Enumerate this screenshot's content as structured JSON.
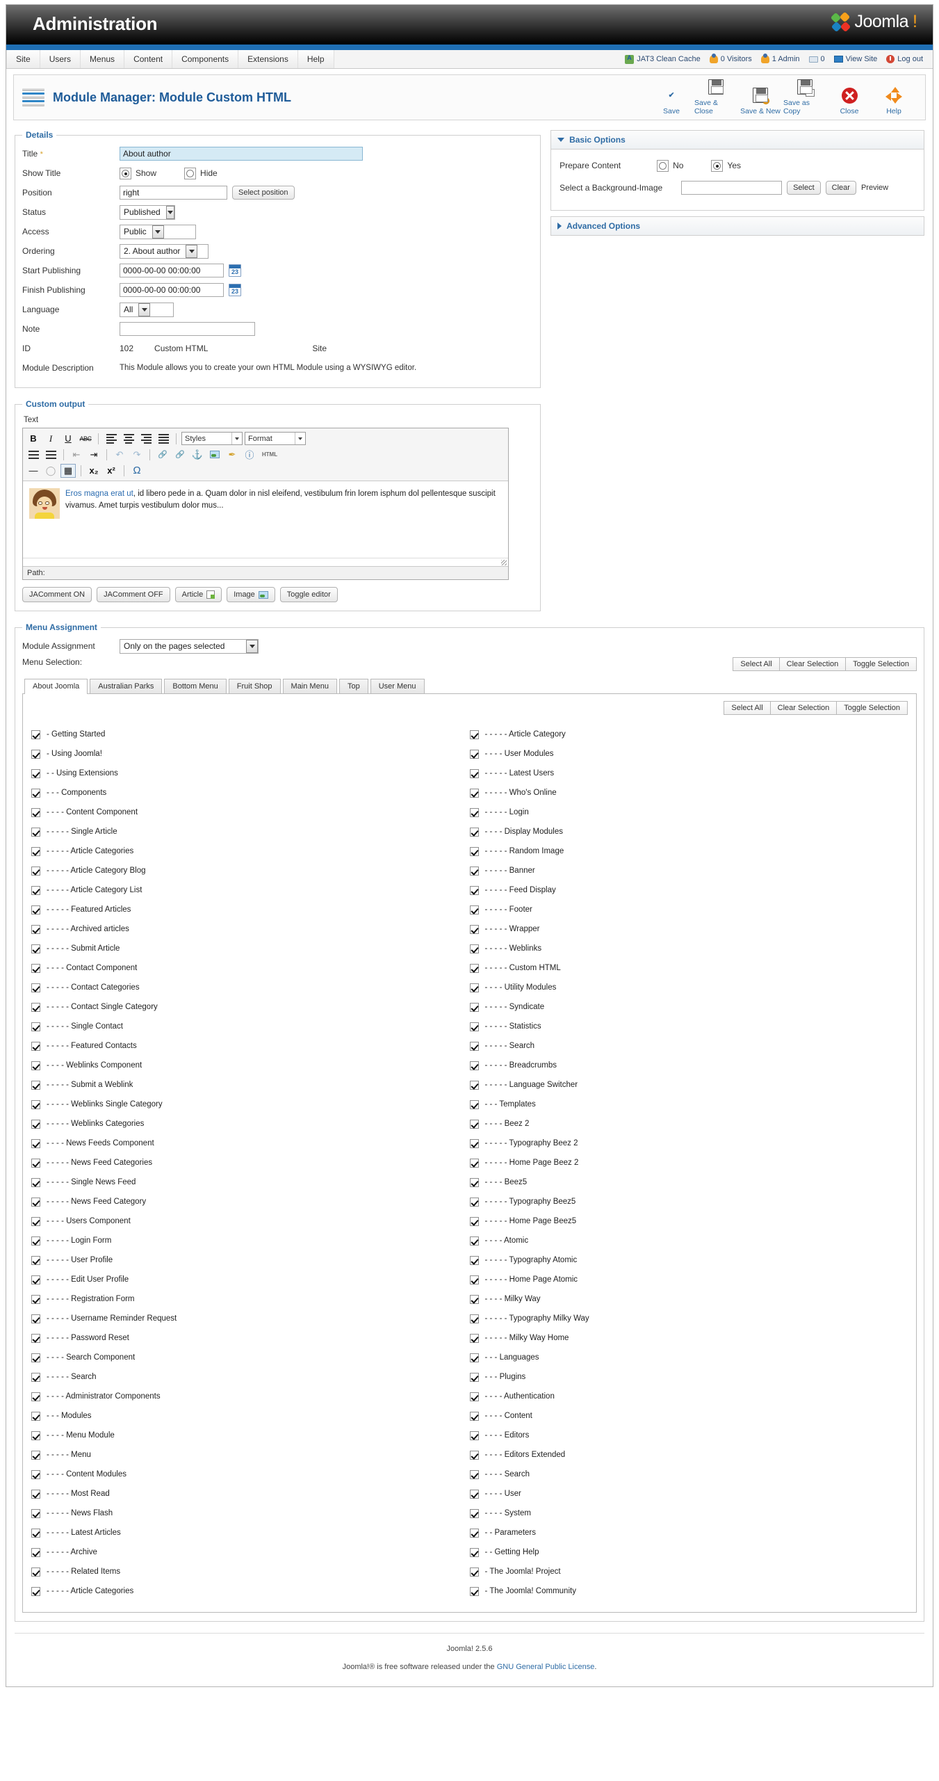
{
  "header": {
    "admin_title": "Administration",
    "brand": "Joomla",
    "brand_excl": "!",
    "menu": [
      "Site",
      "Users",
      "Menus",
      "Content",
      "Components",
      "Extensions",
      "Help"
    ],
    "status": [
      {
        "label": "JAT3 Clean Cache",
        "icon": "cache-icon"
      },
      {
        "label": "0 Visitors",
        "icon": "visitors-icon"
      },
      {
        "label": "1 Admin",
        "icon": "admin-icon"
      },
      {
        "label": "0",
        "icon": "messages-icon"
      },
      {
        "label": "View Site",
        "icon": "view-site-icon"
      },
      {
        "label": "Log out",
        "icon": "logout-icon"
      }
    ]
  },
  "toolbar": {
    "page_title": "Module Manager: Module Custom HTML",
    "buttons": [
      {
        "label": "Save",
        "icon": "check-icon"
      },
      {
        "label": "Save & Close",
        "icon": "floppy-icon"
      },
      {
        "label": "Save & New",
        "icon": "floppy-plus-icon"
      },
      {
        "label": "Save as Copy",
        "icon": "floppy-copy-icon"
      },
      {
        "label": "Close",
        "icon": "close-icon"
      },
      {
        "label": "Help",
        "icon": "help-icon"
      }
    ]
  },
  "details": {
    "legend": "Details",
    "labels": {
      "title": "Title",
      "show_title": "Show Title",
      "position": "Position",
      "status": "Status",
      "access": "Access",
      "ordering": "Ordering",
      "start_publishing": "Start Publishing",
      "finish_publishing": "Finish Publishing",
      "language": "Language",
      "note": "Note",
      "id": "ID",
      "module_description": "Module Description"
    },
    "title_value": "About author",
    "show_title_options": [
      "Show",
      "Hide"
    ],
    "show_title_selected": "Show",
    "position_value": "right",
    "select_position_button": "Select position",
    "status_value": "Published",
    "access_value": "Public",
    "ordering_value": "2. About author",
    "start_publishing_value": "0000-00-00 00:00:00",
    "finish_publishing_value": "0000-00-00 00:00:00",
    "language_value": "All",
    "note_value": "",
    "id_value": "102",
    "id_type": "Custom HTML",
    "id_scope": "Site",
    "module_description_text": "This Module allows you to create your own HTML Module using a WYSIWYG editor."
  },
  "basic_options": {
    "legend": "Basic Options",
    "prepare_content_label": "Prepare Content",
    "prepare_content_options": [
      "No",
      "Yes"
    ],
    "prepare_content_selected": "Yes",
    "background_label": "Select a Background-Image",
    "background_value": "",
    "select_button": "Select",
    "clear_button": "Clear",
    "preview_label": "Preview"
  },
  "advanced_options": {
    "legend": "Advanced Options"
  },
  "custom_output": {
    "legend": "Custom output",
    "text_label": "Text",
    "editor_toolbar": {
      "bold": "B",
      "italic": "I",
      "underline": "U",
      "strikethrough": "ABC",
      "styles_select": "Styles",
      "format_select": "Format",
      "html_button": "HTML"
    },
    "content_link": "Eros magna erat ut",
    "content_text": ", id libero pede in a. Quam dolor in nisl eleifend, vestibulum frin lorem isphum dol pellentesque suscipit vivamus. Amet turpis vestibulum dolor mus...",
    "path_label": "Path:",
    "path_value": "",
    "buttons": [
      "JAComment ON",
      "JAComment OFF",
      "Article",
      "Image",
      "Toggle editor"
    ]
  },
  "menu_assignment": {
    "legend": "Menu Assignment",
    "module_assignment_label": "Module Assignment",
    "module_assignment_value": "Only on the pages selected",
    "menu_selection_label": "Menu Selection:",
    "selection_buttons": [
      "Select All",
      "Clear Selection",
      "Toggle Selection"
    ],
    "tabs": [
      "About Joomla",
      "Australian Parks",
      "Bottom Menu",
      "Fruit Shop",
      "Main Menu",
      "Top",
      "User Menu"
    ],
    "active_tab": "About Joomla",
    "left_items": [
      "- Getting Started",
      "- Using Joomla!",
      "- - Using Extensions",
      "- - - Components",
      "- - - - Content Component",
      "- - - - - Single Article",
      "- - - - - Article Categories",
      "- - - - - Article Category Blog",
      "- - - - - Article Category List",
      "- - - - - Featured Articles",
      "- - - - - Archived articles",
      "- - - - - Submit Article",
      "- - - - Contact Component",
      "- - - - - Contact Categories",
      "- - - - - Contact Single Category",
      "- - - - - Single Contact",
      "- - - - - Featured Contacts",
      "- - - - Weblinks Component",
      "- - - - - Submit a Weblink",
      "- - - - - Weblinks Single Category",
      "- - - - - Weblinks Categories",
      "- - - - News Feeds Component",
      "- - - - - News Feed Categories",
      "- - - - - Single News Feed",
      "- - - - - News Feed Category",
      "- - - - Users Component",
      "- - - - - Login Form",
      "- - - - - User Profile",
      "- - - - - Edit User Profile",
      "- - - - - Registration Form",
      "- - - - - Username Reminder Request",
      "- - - - - Password Reset",
      "- - - - Search Component",
      "- - - - - Search",
      "- - - - Administrator Components",
      "- - - Modules",
      "- - - - Menu Module",
      "- - - - - Menu",
      "- - - - Content Modules",
      "- - - - - Most Read",
      "- - - - - News Flash",
      "- - - - - Latest Articles",
      "- - - - - Archive",
      "- - - - - Related Items",
      "- - - - - Article Categories"
    ],
    "right_items": [
      "- - - - - Article Category",
      "- - - - User Modules",
      "- - - - - Latest Users",
      "- - - - - Who's Online",
      "- - - - - Login",
      "- - - - Display Modules",
      "- - - - - Random Image",
      "- - - - - Banner",
      "- - - - - Feed Display",
      "- - - - - Footer",
      "- - - - - Wrapper",
      "- - - - - Weblinks",
      "- - - - - Custom HTML",
      "- - - - Utility Modules",
      "- - - - - Syndicate",
      "- - - - - Statistics",
      "- - - - - Search",
      "- - - - - Breadcrumbs",
      "- - - - - Language Switcher",
      "- - - Templates",
      "- - - - Beez 2",
      "- - - - - Typography Beez 2",
      "- - - - - Home Page Beez 2",
      "- - - - Beez5",
      "- - - - - Typography Beez5",
      "- - - - - Home Page Beez5",
      "- - - - Atomic",
      "- - - - - Typography Atomic",
      "- - - - - Home Page Atomic",
      "- - - - Milky Way",
      "- - - - - Typography Milky Way",
      "- - - - - Milky Way Home",
      "- - - Languages",
      "- - - Plugins",
      "- - - - Authentication",
      "- - - - Content",
      "- - - - Editors",
      "- - - - Editors Extended",
      "- - - - Search",
      "- - - - User",
      "- - - - System",
      "- - Parameters",
      "- - Getting Help",
      "- The Joomla! Project",
      "- The Joomla! Community"
    ]
  },
  "footer": {
    "version": "Joomla! 2.5.6",
    "license_pre": "Joomla!® is free software released under the ",
    "license_link": "GNU General Public License",
    "license_post": "."
  },
  "colors": {
    "accent": "#2f6ca5",
    "bluebar": "#1f6fb5",
    "title_field_bg": "#d5eaf5"
  }
}
